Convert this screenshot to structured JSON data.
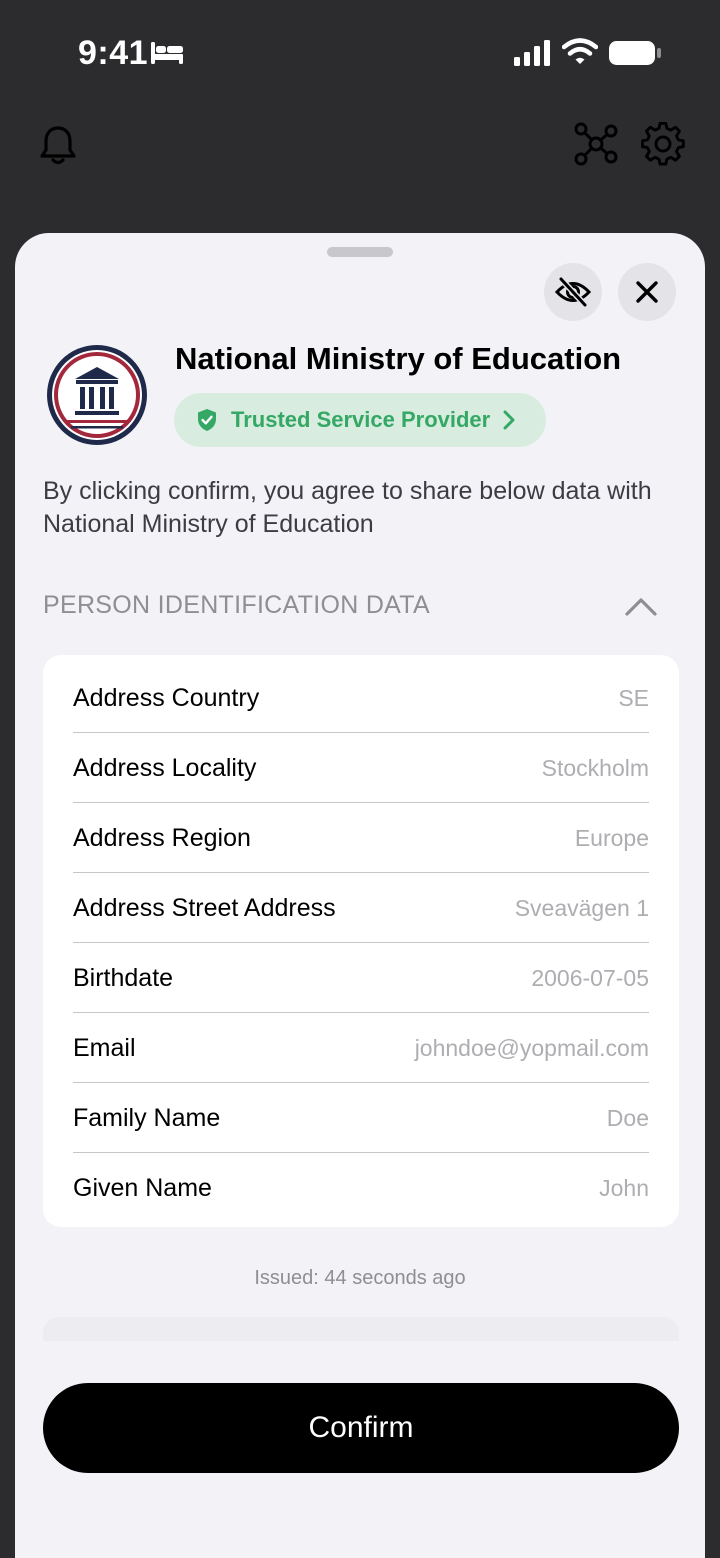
{
  "status_bar": {
    "time": "9:41"
  },
  "header": {
    "icons": [
      "bell-icon",
      "network-icon",
      "gear-icon"
    ]
  },
  "sheet": {
    "icons": [
      "eye-slash-icon",
      "close-icon"
    ],
    "org_name": "National Ministry of Education",
    "badge_label": "Trusted Service Provider",
    "consent_text": "By clicking confirm, you agree to share below data with National Ministry of Education",
    "section_title": "PERSON IDENTIFICATION DATA",
    "fields": [
      {
        "label": "Address Country",
        "value": "SE"
      },
      {
        "label": "Address Locality",
        "value": "Stockholm"
      },
      {
        "label": "Address Region",
        "value": "Europe"
      },
      {
        "label": "Address Street Address",
        "value": "Sveavägen 1"
      },
      {
        "label": "Birthdate",
        "value": "2006-07-05"
      },
      {
        "label": "Email",
        "value": "johndoe@yopmail.com"
      },
      {
        "label": "Family Name",
        "value": "Doe"
      },
      {
        "label": "Given Name",
        "value": "John"
      }
    ],
    "issued_text": "Issued: 44 seconds ago",
    "confirm_label": "Confirm"
  },
  "colors": {
    "accent_green": "#34a864",
    "badge_bg": "#d8ecdf",
    "logo_navy": "#1f2a4a",
    "logo_red": "#a3283c",
    "button_black": "#000000"
  }
}
